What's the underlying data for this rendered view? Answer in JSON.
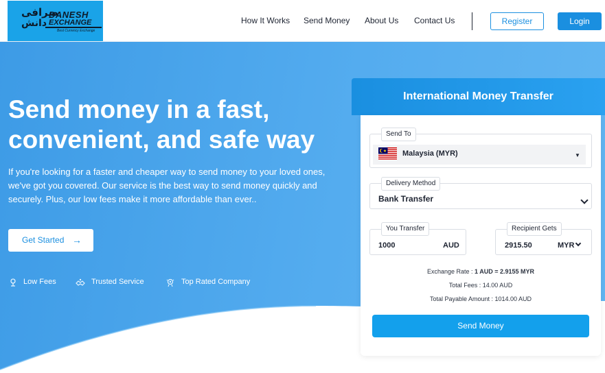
{
  "brand": {
    "name_line1": "DANESH",
    "name_line2": "EXCHANGE",
    "arabic_line1": "صرافی",
    "arabic_line2": "دانش",
    "tagline": "Best Currency Exchange",
    "bg_color": "#1aa3e8"
  },
  "nav": {
    "items": [
      {
        "label": "How It Works"
      },
      {
        "label": "Send Money"
      },
      {
        "label": "About Us"
      },
      {
        "label": "Contact Us"
      }
    ],
    "register_label": "Register",
    "login_label": "Login"
  },
  "hero": {
    "title": "Send money in a fast, convenient, and safe way",
    "description": "If you're looking for a faster and cheaper way to send money to your loved ones, we've got you covered. Our service is the best way to send money quickly and securely. Plus, our low fees make it more affordable than ever..",
    "cta_label": "Get Started",
    "features": [
      {
        "label": "Low Fees",
        "icon": "location-pin-icon"
      },
      {
        "label": "Trusted Service",
        "icon": "handshake-icon"
      },
      {
        "label": "Top Rated Company",
        "icon": "award-icon"
      }
    ]
  },
  "transfer": {
    "title": "International Money Transfer",
    "send_to_label": "Send To",
    "country": "Malaysia (MYR)",
    "delivery_label": "Delivery Method",
    "delivery_value": "Bank Transfer",
    "you_transfer_label": "You Transfer",
    "you_transfer_amount": "1000",
    "you_transfer_currency": "AUD",
    "recipient_label": "Recipient Gets",
    "recipient_amount": "2915.50",
    "recipient_currency": "MYR",
    "rate_prefix": "Exchange Rate : ",
    "rate_value": "1 AUD = 2.9155 MYR",
    "total_fees": "Total Fees : 14.00 AUD",
    "total_payable": "Total Payable Amount : 1014.00 AUD",
    "send_label": "Send Money"
  },
  "colors": {
    "primary": "#1a8fe0",
    "hero_start": "#3d9be6",
    "hero_end": "#62b6f2",
    "send_button": "#13a0ec"
  }
}
